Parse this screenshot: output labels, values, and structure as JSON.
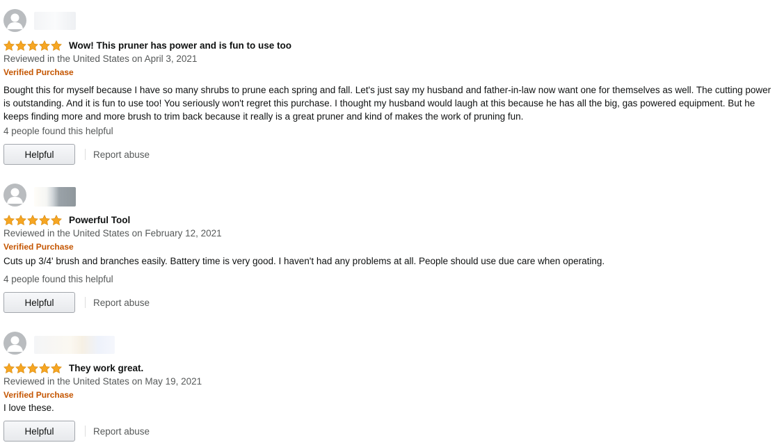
{
  "colors": {
    "star": "#f6a623",
    "verified": "#c45500",
    "meta": "#565959"
  },
  "reviews": [
    {
      "rating": 5,
      "title": "Wow! This pruner has power and is fun to use too",
      "meta": "Reviewed in the United States on April 3, 2021",
      "verified": "Verified Purchase",
      "body": "Bought this for myself because I have so many shrubs to prune each spring and fall. Let's just say my husband and father-in-law now want one for themselves as well. The cutting power is outstanding. And it is fun to use too! You seriously won't regret this purchase. I thought my husband would laugh at this because he has all the big, gas powered equipment. But he keeps finding more and more brush to trim back because it really is a great pruner and kind of makes the work of pruning fun.",
      "helpful_count": "4 people found this helpful",
      "helpful_label": "Helpful",
      "report_label": "Report abuse"
    },
    {
      "rating": 5,
      "title": "Powerful Tool",
      "meta": "Reviewed in the United States on February 12, 2021",
      "verified": "Verified Purchase",
      "body": "Cuts up 3/4' brush and branches easily. Battery time is very good. I haven't had any problems at all. People should use due care when operating.",
      "helpful_count": "4 people found this helpful",
      "helpful_label": "Helpful",
      "report_label": "Report abuse"
    },
    {
      "rating": 5,
      "title": "They work great.",
      "meta": "Reviewed in the United States on May 19, 2021",
      "verified": "Verified Purchase",
      "body": "I love these.",
      "helpful_label": "Helpful",
      "report_label": "Report abuse"
    }
  ]
}
